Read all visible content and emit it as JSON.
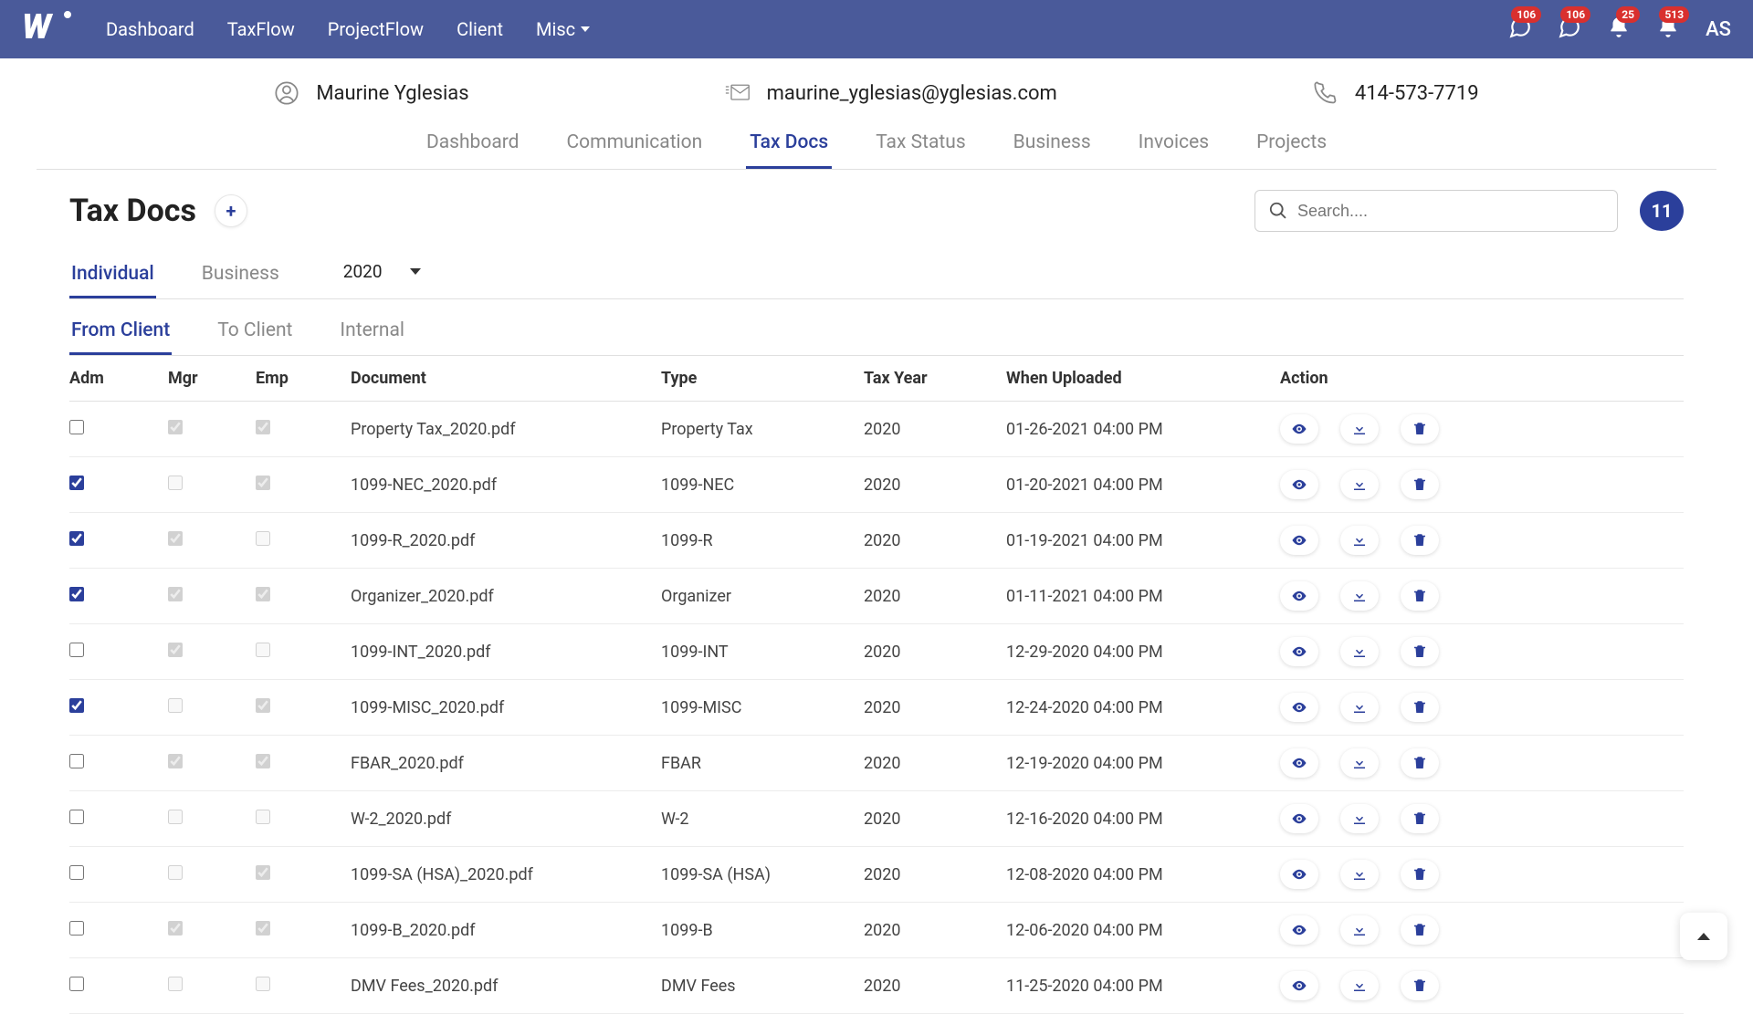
{
  "topnav": {
    "items": [
      "Dashboard",
      "TaxFlow",
      "ProjectFlow",
      "Client",
      "Misc"
    ]
  },
  "badges": {
    "chat1": "106",
    "chat2": "106",
    "bell1": "25",
    "bell2": "513"
  },
  "user_initials": "AS",
  "client": {
    "name": "Maurine Yglesias",
    "email": "maurine_yglesias@yglesias.com",
    "phone": "414-573-7719"
  },
  "subtabs": [
    "Dashboard",
    "Communication",
    "Tax Docs",
    "Tax Status",
    "Business",
    "Invoices",
    "Projects"
  ],
  "subtab_active": 2,
  "page_title": "Tax Docs",
  "search_placeholder": "Search....",
  "doc_count": "11",
  "scope_tabs": [
    "Individual",
    "Business"
  ],
  "scope_active": 0,
  "year_selected": "2020",
  "direction_tabs": [
    "From Client",
    "To Client",
    "Internal"
  ],
  "direction_active": 0,
  "columns": [
    "Adm",
    "Mgr",
    "Emp",
    "Document",
    "Type",
    "Tax Year",
    "When Uploaded",
    "Action"
  ],
  "rows": [
    {
      "adm": false,
      "mgr_checked": true,
      "mgr_disabled": true,
      "emp_checked": true,
      "emp_disabled": true,
      "doc": "Property Tax_2020.pdf",
      "type": "Property Tax",
      "year": "2020",
      "uploaded": "01-26-2021 04:00 PM"
    },
    {
      "adm": true,
      "mgr_checked": false,
      "mgr_disabled": true,
      "emp_checked": true,
      "emp_disabled": true,
      "doc": "1099-NEC_2020.pdf",
      "type": "1099-NEC",
      "year": "2020",
      "uploaded": "01-20-2021 04:00 PM"
    },
    {
      "adm": true,
      "mgr_checked": true,
      "mgr_disabled": true,
      "emp_checked": false,
      "emp_disabled": true,
      "doc": "1099-R_2020.pdf",
      "type": "1099-R",
      "year": "2020",
      "uploaded": "01-19-2021 04:00 PM"
    },
    {
      "adm": true,
      "mgr_checked": true,
      "mgr_disabled": true,
      "emp_checked": true,
      "emp_disabled": true,
      "doc": "Organizer_2020.pdf",
      "type": "Organizer",
      "year": "2020",
      "uploaded": "01-11-2021 04:00 PM"
    },
    {
      "adm": false,
      "mgr_checked": true,
      "mgr_disabled": true,
      "emp_checked": false,
      "emp_disabled": true,
      "doc": "1099-INT_2020.pdf",
      "type": "1099-INT",
      "year": "2020",
      "uploaded": "12-29-2020 04:00 PM"
    },
    {
      "adm": true,
      "mgr_checked": false,
      "mgr_disabled": true,
      "emp_checked": true,
      "emp_disabled": true,
      "doc": "1099-MISC_2020.pdf",
      "type": "1099-MISC",
      "year": "2020",
      "uploaded": "12-24-2020 04:00 PM"
    },
    {
      "adm": false,
      "mgr_checked": true,
      "mgr_disabled": true,
      "emp_checked": true,
      "emp_disabled": true,
      "doc": "FBAR_2020.pdf",
      "type": "FBAR",
      "year": "2020",
      "uploaded": "12-19-2020 04:00 PM"
    },
    {
      "adm": false,
      "mgr_checked": false,
      "mgr_disabled": true,
      "emp_checked": false,
      "emp_disabled": true,
      "doc": "W-2_2020.pdf",
      "type": "W-2",
      "year": "2020",
      "uploaded": "12-16-2020 04:00 PM"
    },
    {
      "adm": false,
      "mgr_checked": false,
      "mgr_disabled": true,
      "emp_checked": true,
      "emp_disabled": true,
      "doc": "1099-SA (HSA)_2020.pdf",
      "type": "1099-SA (HSA)",
      "year": "2020",
      "uploaded": "12-08-2020 04:00 PM"
    },
    {
      "adm": false,
      "mgr_checked": true,
      "mgr_disabled": true,
      "emp_checked": true,
      "emp_disabled": true,
      "doc": "1099-B_2020.pdf",
      "type": "1099-B",
      "year": "2020",
      "uploaded": "12-06-2020 04:00 PM"
    },
    {
      "adm": false,
      "mgr_checked": false,
      "mgr_disabled": true,
      "emp_checked": false,
      "emp_disabled": true,
      "doc": "DMV Fees_2020.pdf",
      "type": "DMV Fees",
      "year": "2020",
      "uploaded": "11-25-2020 04:00 PM"
    }
  ]
}
